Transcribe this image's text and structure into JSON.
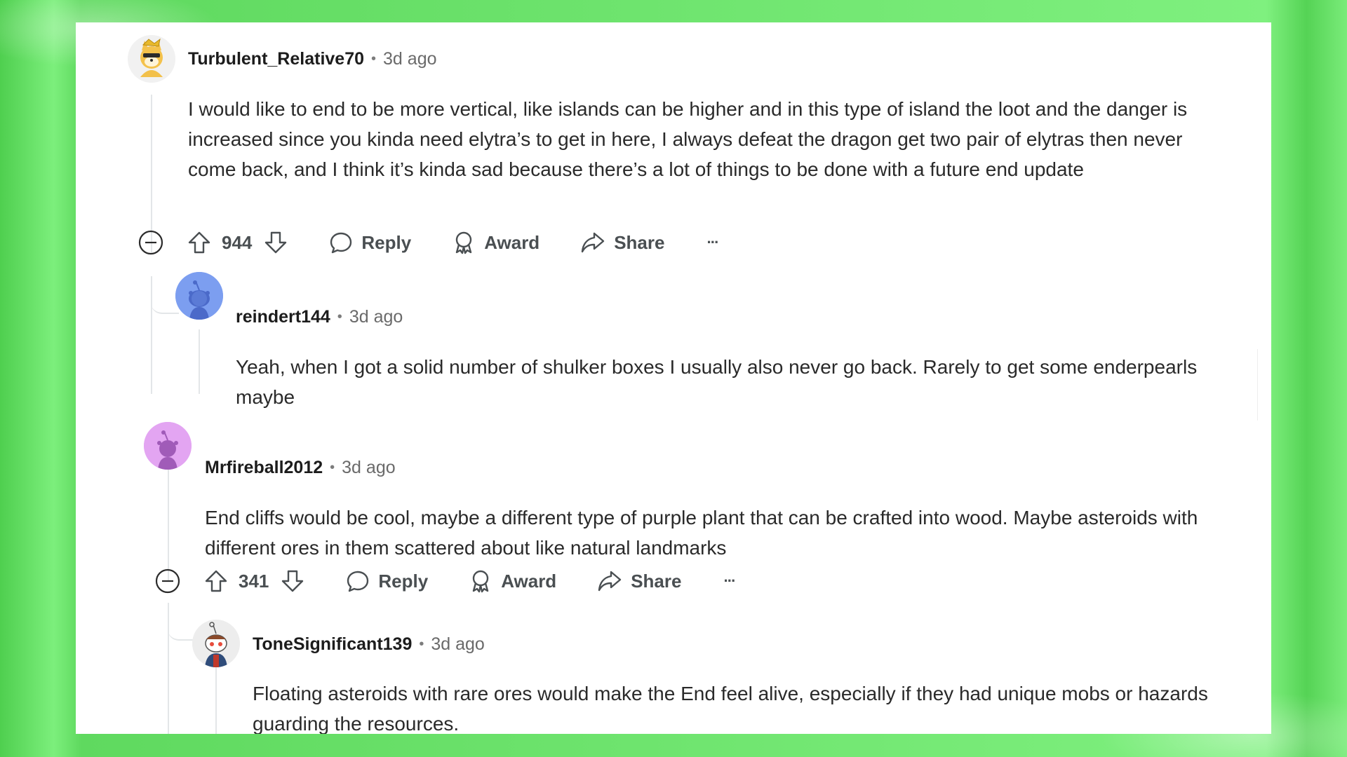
{
  "comments": [
    {
      "username": "Turbulent_Relative70",
      "separator": "•",
      "time": "3d ago",
      "body": "I would like to end to be more vertical, like islands can be higher and in this type of island the loot and the danger is increased since you kinda need elytra’s to get in here, I always defeat the dragon get two pair of elytras then never come back, and I think it’s kinda sad because there’s a lot of things to be done with a future end update",
      "votes": "944",
      "reply_label": "Reply",
      "award_label": "Award",
      "share_label": "Share",
      "more_label": "···",
      "avatar_icon": "shiba-doge-avatar-icon"
    },
    {
      "username": "reindert144",
      "separator": "•",
      "time": "3d ago",
      "body": "Yeah, when I got a solid number of shulker boxes I usually also never go back. Rarely to get some enderpearls maybe",
      "avatar_icon": "blue-snoo-avatar-icon",
      "avatar_color": "#7c9ef0"
    },
    {
      "username": "Mrfireball2012",
      "separator": "•",
      "time": "3d ago",
      "body": "End cliffs would be cool, maybe a different type of purple plant that can be crafted into wood. Maybe asteroids with different ores in them scattered about like natural landmarks",
      "votes": "341",
      "reply_label": "Reply",
      "award_label": "Award",
      "share_label": "Share",
      "more_label": "···",
      "avatar_icon": "purple-snoo-avatar-icon",
      "avatar_color": "#e3a5f2"
    },
    {
      "username": "ToneSignificant139",
      "separator": "•",
      "time": "3d ago",
      "body": "Floating asteroids with rare ores would make the End feel alive, especially if they had unique mobs or hazards guarding the resources.",
      "avatar_icon": "snoo-character-avatar-icon"
    }
  ],
  "colors": {
    "background": "#6be36b",
    "card": "#ffffff",
    "thread_line": "#e3e6e8",
    "text": "#2a2a2a",
    "muted": "#6a6a6a"
  }
}
